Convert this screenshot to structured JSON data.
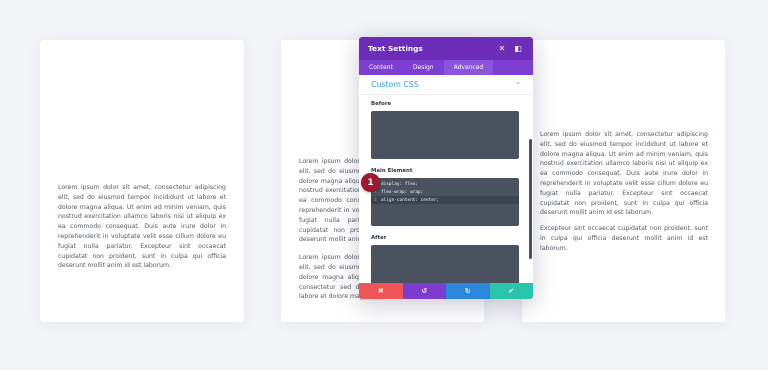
{
  "cards": {
    "left": {
      "paragraph": "Lorem ipsum dolor sit amet, consectetur adipiscing elit, sed do eiusmod tempor incididunt ut labore et dolore magna aliqua. Ut enim ad minim veniam, quis nostrud exercitation ullamco laboris nisi ut aliquip ex ea commodo consequat. Duis aute irure dolor in reprehenderit in voluptate velit esse cillum dolore eu fugiat nulla pariatur. Excepteur sint occaecat cupidatat non proident, sunt in culpa qui officia deserunt mollit anim id est laborum."
    },
    "middle": {
      "paragraph1": "Lorem ipsum dolor sit amet, consectetur adipiscing elit, sed do eiusmod tempor incididunt ut labore et dolore magna aliqua. Ut enim ad minim veniam, quis nostrud exercitation ullamco laboris nisi ut aliquip ex ea commodo consequat. Duis aute irure dolor in reprehenderit in voluptate velit esse cillum dolore eu fugiat nulla pariatur. Excepteur sint occaecat cupidatat non proident, sunt in culpa qui officia deserunt mollit anim id est laborum.",
      "paragraph2": "Lorem ipsum dolor sit amet, consectetur adipiscing elit, sed do eiusmod tempor incididunt ut labore et dolore magna aliqua. Lorem ipsum dolor sit amet, consectetur sed do eiusmod tempor incididunt ut labore et dolore magna aliqua."
    },
    "right": {
      "paragraph1": "Lorem ipsum dolor sit amet, consectetur adipiscing elit, sed do eiusmod tempor incididunt ut labore et dolore magna aliqua. Ut enim ad minim veniam, quis nostrud exercitation ullamco laboris nisi ut aliquip ex ea commodo consequat. Duis aute irure dolor in reprehenderit in voluptate velit esse cillum dolore eu fugiat nulla pariatur. Excepteur sint occaecat cupidatat non proident, sunt in culpa qui officia deserunt mollit anim id est laborum.",
      "paragraph2": "Excepteur sint occaecat cupidatat non proident, sunt in culpa qui officia deserunt mollit anim id est laborum."
    }
  },
  "modal": {
    "title": "Text Settings",
    "close_icon": "✕",
    "expand_icon": "◧",
    "tabs": [
      {
        "label": "Content"
      },
      {
        "label": "Design"
      },
      {
        "label": "Advanced"
      }
    ],
    "active_tab": "Advanced",
    "section_title": "Custom CSS",
    "section_chevron": "⌃",
    "before_label": "Before",
    "main_label": "Main Element",
    "after_label": "After",
    "main_code": [
      {
        "line": "1",
        "text": "display: flex;"
      },
      {
        "line": "2",
        "text": "flex-wrap: wrap;"
      },
      {
        "line": "3",
        "text": "align-content: center;"
      }
    ],
    "badge": "1",
    "footer": {
      "cancel": "✖",
      "undo": "↺",
      "redo": "↻",
      "save": "✔"
    }
  },
  "colors": {
    "header": "#6c2eb9",
    "tabs": "#7c3fd1",
    "accent": "#2ea3f2",
    "code_bg": "#4a5260",
    "badge": "#a1172c",
    "cancel": "#ef5555",
    "undo": "#7e3bd0",
    "redo": "#2b87da",
    "save": "#29c4a9"
  }
}
